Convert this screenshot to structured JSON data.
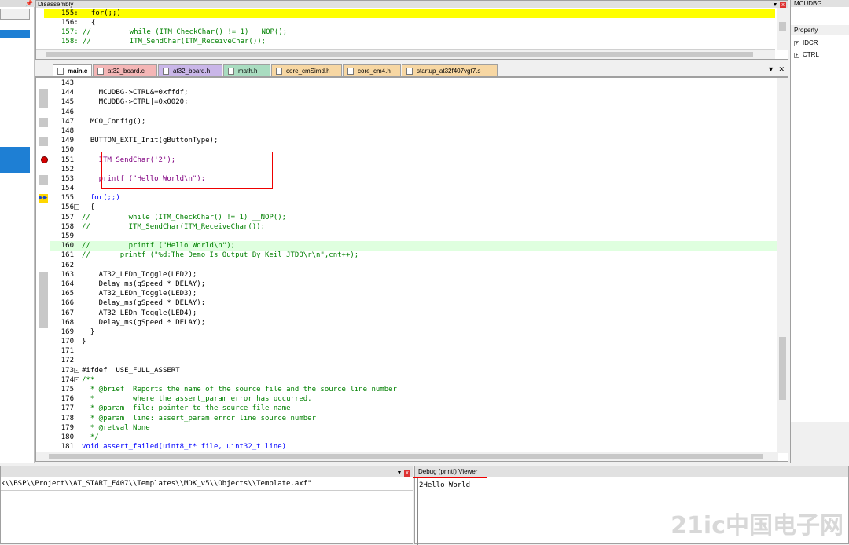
{
  "disassembly": {
    "title": "Disassembly",
    "lines": [
      "155:   for(;;)",
      "156:   {",
      "157: //         while (ITM_CheckChar() != 1) __NOP();",
      "158: //         ITM_SendChar(ITM_ReceiveChar());"
    ]
  },
  "tabs": [
    {
      "label": "main.c",
      "color": "#f0f0f0"
    },
    {
      "label": "at32_board.c",
      "color": "#f4b6b6"
    },
    {
      "label": "at32_board.h",
      "color": "#c9b6e8"
    },
    {
      "label": "math.h",
      "color": "#a9dcc0"
    },
    {
      "label": "core_cmSimd.h",
      "color": "#f7d7a3"
    },
    {
      "label": "core_cm4.h",
      "color": "#f7d7a3"
    },
    {
      "label": "startup_at32f407vgt7.s",
      "color": "#f7d7a3"
    }
  ],
  "code": [
    {
      "n": "143",
      "t": ""
    },
    {
      "n": "144",
      "t": "    MCUDBG->CTRL&=0xffdf;"
    },
    {
      "n": "145",
      "t": "    MCUDBG->CTRL|=0x0020;"
    },
    {
      "n": "146",
      "t": ""
    },
    {
      "n": "147",
      "t": "  MCO_Config();"
    },
    {
      "n": "148",
      "t": ""
    },
    {
      "n": "149",
      "t": "  BUTTON_EXTI_Init(gButtonType);"
    },
    {
      "n": "150",
      "t": ""
    },
    {
      "n": "151",
      "t": "    ITM_SendChar('2');"
    },
    {
      "n": "152",
      "t": ""
    },
    {
      "n": "153",
      "t": "    printf (\"Hello World\\n\");"
    },
    {
      "n": "154",
      "t": ""
    },
    {
      "n": "155",
      "t": "  for(;;)"
    },
    {
      "n": "156",
      "t": "  {"
    },
    {
      "n": "157",
      "t": "//         while (ITM_CheckChar() != 1) __NOP();"
    },
    {
      "n": "158",
      "t": "//         ITM_SendChar(ITM_ReceiveChar());"
    },
    {
      "n": "159",
      "t": ""
    },
    {
      "n": "160",
      "t": "//         printf (\"Hello World\\n\");"
    },
    {
      "n": "161",
      "t": "//       printf (\"%d:The_Demo_Is_Output_By_Keil_JTDO\\r\\n\",cnt++);"
    },
    {
      "n": "162",
      "t": ""
    },
    {
      "n": "163",
      "t": "    AT32_LEDn_Toggle(LED2);"
    },
    {
      "n": "164",
      "t": "    Delay_ms(gSpeed * DELAY);"
    },
    {
      "n": "165",
      "t": "    AT32_LEDn_Toggle(LED3);"
    },
    {
      "n": "166",
      "t": "    Delay_ms(gSpeed * DELAY);"
    },
    {
      "n": "167",
      "t": "    AT32_LEDn_Toggle(LED4);"
    },
    {
      "n": "168",
      "t": "    Delay_ms(gSpeed * DELAY);"
    },
    {
      "n": "169",
      "t": "  }"
    },
    {
      "n": "170",
      "t": "}"
    },
    {
      "n": "171",
      "t": ""
    },
    {
      "n": "172",
      "t": ""
    },
    {
      "n": "173",
      "t": "#ifdef  USE_FULL_ASSERT"
    },
    {
      "n": "174",
      "t": "/**"
    },
    {
      "n": "175",
      "t": "  * @brief  Reports the name of the source file and the source line number"
    },
    {
      "n": "176",
      "t": "  *         where the assert_param error has occurred."
    },
    {
      "n": "177",
      "t": "  * @param  file: pointer to the source file name"
    },
    {
      "n": "178",
      "t": "  * @param  line: assert_param error line source number"
    },
    {
      "n": "179",
      "t": "  * @retval None"
    },
    {
      "n": "180",
      "t": "  */"
    },
    {
      "n": "181",
      "t": "void assert_failed(uint8_t* file, uint32_t line)"
    }
  ],
  "right_panel": {
    "title": "MCUDBG",
    "property_header": "Property",
    "registers": [
      "IDCR",
      "CTRL"
    ]
  },
  "command": {
    "text": "k\\\\BSP\\\\Project\\\\AT_START_F407\\\\Templates\\\\MDK_v5\\\\Objects\\\\Template.axf\""
  },
  "debug_viewer": {
    "title": "Debug (printf) Viewer",
    "output": "2Hello World"
  },
  "watermark": "21ic中国电子网"
}
